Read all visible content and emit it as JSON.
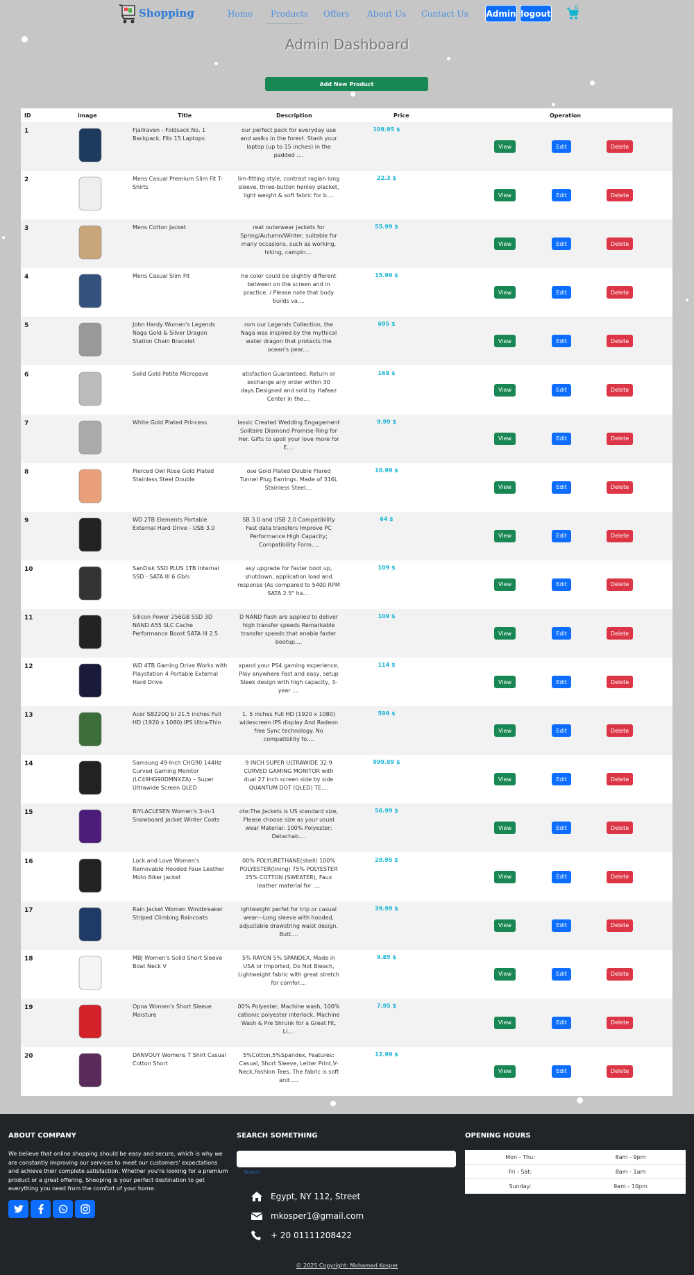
{
  "nav": {
    "brand": "Shopping",
    "links": [
      "Home",
      "Products",
      "Offers",
      "About Us",
      "Contact Us"
    ],
    "admin_label": "Admin",
    "logout_label": "logout",
    "cart_count": "0"
  },
  "page": {
    "title": "Admin Dashboard",
    "add_button": "Add New Product"
  },
  "table": {
    "headers": [
      "ID",
      "image",
      "Title",
      "Description",
      "Price",
      "Operation"
    ],
    "view_label": "View",
    "edit_label": "Edit",
    "delete_label": "Delete",
    "rows": [
      {
        "id": "1",
        "title": "Fjallraven - Foldsack No. 1 Backpack, Fits 15 Laptops",
        "desc": "our perfect pack for everyday use and walks in the forest. Stash your laptop (up to 15 inches) in the padded ....",
        "price": "109.95 $",
        "image": "backpack-image"
      },
      {
        "id": "2",
        "title": "Mens Casual Premium Slim Fit T-Shirts",
        "desc": "lim-fitting style, contrast raglan long sleeve, three-button henley placket, light weight & soft fabric for b....",
        "price": "22.3 $",
        "image": "tshirt-image"
      },
      {
        "id": "3",
        "title": "Mens Cotton Jacket",
        "desc": "reat outerwear jackets for Spring/Autumn/Winter, suitable for many occasions, such as working, hiking, campin....",
        "price": "55.99 $",
        "image": "jacket-image"
      },
      {
        "id": "4",
        "title": "Mens Casual Slim Fit",
        "desc": "he color could be slightly different between on the screen and in practice. / Please note that body builds va....",
        "price": "15.99 $",
        "image": "longsleeve-image"
      },
      {
        "id": "5",
        "title": "John Hardy Women's Legends Naga Gold & Silver Dragon Station Chain Bracelet",
        "desc": "rom our Legends Collection, the Naga was inspired by the mythical water dragon that protects the ocean's pear....",
        "price": "695 $",
        "image": "bracelet-image"
      },
      {
        "id": "6",
        "title": "Solid Gold Petite Micropave",
        "desc": "atisfaction Guaranteed. Return or exchange any order within 30 days.Designed and sold by Hafeez Center in the....",
        "price": "168 $",
        "image": "ring-image"
      },
      {
        "id": "7",
        "title": "White Gold Plated Princess",
        "desc": "lassic Created Wedding Engagement Solitaire Diamond Promise Ring for Her. Gifts to spoil your love more for E....",
        "price": "9.99 $",
        "image": "princess-ring-image"
      },
      {
        "id": "8",
        "title": "Pierced Owl Rose Gold Plated Stainless Steel Double",
        "desc": "ose Gold Plated Double Flared Tunnel Plug Earrings. Made of 316L Stainless Steel....",
        "price": "10.99 $",
        "image": "earrings-image"
      },
      {
        "id": "9",
        "title": "WD 2TB Elements Portable External Hard Drive - USB 3.0",
        "desc": "SB 3.0 and USB 2.0 Compatibility Fast data transfers Improve PC Performance High Capacity; Compatibility Form....",
        "price": "64 $",
        "image": "hard-drive-image"
      },
      {
        "id": "10",
        "title": "SanDisk SSD PLUS 1TB Internal SSD - SATA III 6 Gb/s",
        "desc": "asy upgrade for faster boot up, shutdown, application load and response (As compared to 5400 RPM SATA 2.5\" ha....",
        "price": "109 $",
        "image": "ssd-image"
      },
      {
        "id": "11",
        "title": "Silicon Power 256GB SSD 3D NAND A55 SLC Cache Performance Boost SATA III 2.5",
        "desc": "D NAND flash are applied to deliver high transfer speeds Remarkable transfer speeds that enable faster bootup....",
        "price": "109 $",
        "image": "ssd-box-image"
      },
      {
        "id": "12",
        "title": "WD 4TB Gaming Drive Works with Playstation 4 Portable External Hard Drive",
        "desc": "xpand your PS4 gaming experience, Play anywhere Fast and easy, setup Sleek design with high capacity, 3-year ....",
        "price": "114 $",
        "image": "gaming-drive-image"
      },
      {
        "id": "13",
        "title": "Acer SB220Q bi 21.5 inches Full HD (1920 x 1080) IPS Ultra-Thin",
        "desc": "1. 5 inches Full HD (1920 x 1080) widescreen IPS display And Radeon free Sync technology. No compatibility fo....",
        "price": "599 $",
        "image": "monitor-image"
      },
      {
        "id": "14",
        "title": "Samsung 49-Inch CHG90 144Hz Curved Gaming Monitor (LC49HG90DMNXZA) – Super Ultrawide Screen QLED",
        "desc": "9 INCH SUPER ULTRAWIDE 32:9 CURVED GAMING MONITOR with dual 27 inch screen side by side QUANTUM DOT (QLED) TE....",
        "price": "999.99 $",
        "image": "curved-monitor-image"
      },
      {
        "id": "15",
        "title": "BIYLACLESEN Women's 3-in-1 Snowboard Jacket Winter Coats",
        "desc": "ote:The Jackets is US standard size, Please choose size as your usual wear Material: 100% Polyester; Detachab....",
        "price": "56.99 $",
        "image": "snowboard-jacket-image"
      },
      {
        "id": "16",
        "title": "Lock and Love Women's Removable Hooded Faux Leather Moto Biker Jacket",
        "desc": "00% POLYURETHANE(shell) 100% POLYESTER(lining) 75% POLYESTER 25% COTTON (SWEATER), Faux leather material for ....",
        "price": "29.95 $",
        "image": "leather-jacket-image"
      },
      {
        "id": "17",
        "title": "Rain Jacket Women Windbreaker Striped Climbing Raincoats",
        "desc": "ightweight perfet for trip or casual wear---Long sleeve with hooded, adjustable drawstring waist design. Butt....",
        "price": "39.99 $",
        "image": "raincoat-image"
      },
      {
        "id": "18",
        "title": "MBJ Women's Solid Short Sleeve Boat Neck V",
        "desc": "5% RAYON 5% SPANDEX, Made in USA or Imported, Do Not Bleach, Lightweight fabric with great stretch for comfor....",
        "price": "9.85 $",
        "image": "white-top-image"
      },
      {
        "id": "19",
        "title": "Opna Women's Short Sleeve Moisture",
        "desc": "00% Polyester, Machine wash, 100% cationic polyester interlock, Machine Wash & Pre Shrunk for a Great Fit, Li....",
        "price": "7.95 $",
        "image": "red-shirt-image"
      },
      {
        "id": "20",
        "title": "DANVOUY Womens T Shirt Casual Cotton Short",
        "desc": "5%Cotton,5%Spandex, Features: Casual, Short Sleeve, Letter Print,V-Neck,Fashion Tees, The fabric is soft and ....",
        "price": "12.99 $",
        "image": "printed-tee-image"
      }
    ]
  },
  "footer": {
    "about_heading": "ABOUT COMPANY",
    "about_text": "We believe that online shopping should be easy and secure, which is why we are constantly improving our services to meet our customers' expectations and achieve their complete satisfaction. Whether you're looking for a premium product or a great offering, Shooping is your perfect destination to get everything you need from the comfort of your home.",
    "search_heading": "SEARCH SOMETHING",
    "search_link": "Search",
    "address": "Egypt, NY 112, Street",
    "email": "mkosper1@gmail.com",
    "phone": "+ 20 01111208422",
    "hours_heading": "OPENING HOURS",
    "hours": [
      {
        "day": "Mon - Thu:",
        "time": "8am - 9pm"
      },
      {
        "day": "Fri - Sat:",
        "time": "8am - 1am"
      },
      {
        "day": "Sunday:",
        "time": "9am - 10pm"
      }
    ],
    "copyright": "© 2025 Copyright: Mohamed Kosper"
  },
  "colors": {
    "background": "#c6c6c6",
    "primary": "#0d6efd",
    "success": "#198754",
    "danger": "#dc3545",
    "price": "#17b5d4",
    "footer": "#212529"
  }
}
